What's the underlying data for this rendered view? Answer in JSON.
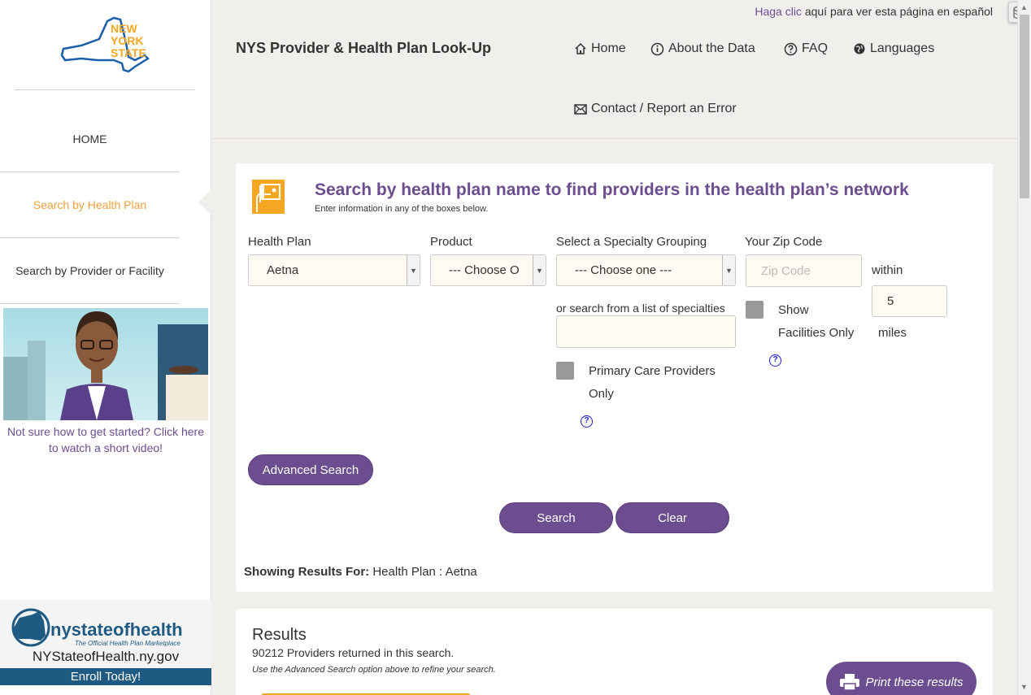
{
  "header": {
    "espanol_link": "Haga clic",
    "espanol_rest": " aquí para ver esta página en español",
    "site_title": "NYS Provider & Health Plan Look-Up",
    "nav": {
      "home": "Home",
      "about": "About the Data",
      "faq": "FAQ",
      "languages": "Languages",
      "contact": "Contact / Report an Error"
    }
  },
  "sidebar": {
    "logo_line1": "NEW",
    "logo_line2": "YORK",
    "logo_line3": "STATE",
    "items": [
      {
        "label": "HOME"
      },
      {
        "label": "Search by Health Plan"
      },
      {
        "label": "Search by Provider or Facility"
      }
    ],
    "video_caption": "Not sure how to get started? Click here to watch a short video!",
    "nyh_brand": "nystateofhealth",
    "nyh_tagline": "The Official Health Plan Marketplace",
    "nyh_site": "NYStateofHealth.ny.gov",
    "enroll": "Enroll Today!"
  },
  "search": {
    "heading": "Search by health plan name to find providers in the health plan’s network",
    "subheading": "Enter information in any of the boxes below.",
    "health_plan_label": "Health Plan",
    "health_plan_value": "Aetna",
    "product_label": "Product",
    "product_value": "--- Choose O",
    "specialty_label": "Select a Specialty Grouping",
    "specialty_value": "--- Choose one ---",
    "specialty_list_label": "or search from a list of specialties",
    "zip_label": "Your Zip Code",
    "zip_placeholder": "Zip Code",
    "within_label": "within",
    "miles_value": "5",
    "miles_label": "miles",
    "show_facilities_line1": "Show",
    "show_facilities_line2": "Facilities Only",
    "pcp_line1": "Primary Care Providers",
    "pcp_line2": "Only",
    "advanced_button": "Advanced Search",
    "search_button": "Search",
    "clear_button": "Clear",
    "showing_label": "Showing Results For:",
    "showing_value": " Health Plan : Aetna"
  },
  "results": {
    "title": "Results",
    "count_text": "90212 Providers returned in this search.",
    "hint": "Use the Advanced Search option above to refine your search.",
    "print_button": "Print these results"
  },
  "colors": {
    "purple": "#6c4d8f",
    "orange": "#f5a623",
    "nav_active": "#f0a03c",
    "enroll_bg": "#1f5a83"
  }
}
